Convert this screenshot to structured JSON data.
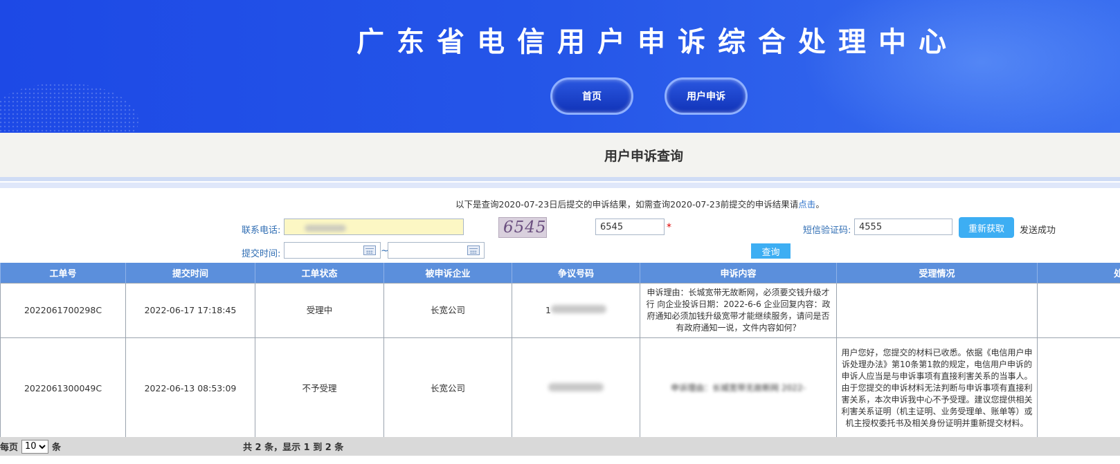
{
  "header": {
    "title": "广东省电信用户申诉综合处理中心",
    "nav": [
      {
        "label": "首页"
      },
      {
        "label": "用户申诉"
      }
    ]
  },
  "section": {
    "title": "用户申诉查询"
  },
  "notice": {
    "text": "以下是查询2020-07-23日后提交的申诉结果，如需查询2020-07-23前提交的申诉结果请",
    "link": "点击",
    "tail": "。"
  },
  "form": {
    "phone_label": "联系电话:",
    "phone_value": "",
    "captcha_image_text": "6545",
    "captcha_value": "6545",
    "required_mark": "*",
    "sms_label": "短信验证码:",
    "sms_value": "4555",
    "resend_label": "重新获取",
    "send_status": "发送成功",
    "time_label": "提交时间:",
    "range_separator": "~",
    "query_label": "查询"
  },
  "table": {
    "headers": [
      "工单号",
      "提交时间",
      "工单状态",
      "被申诉企业",
      "争议号码",
      "申诉内容",
      "受理情况",
      "处"
    ],
    "rows": [
      {
        "order_no": "2022061700298C",
        "submit_time": "2022-06-17 17:18:45",
        "status": "受理中",
        "company": "长宽公司",
        "number": "1",
        "content": "申诉理由：长城宽带无故断网，必须要交钱升级才行 向企业投诉日期：2022-6-6 企业回复内容：政府通知必须加钱升级宽带才能继续服务，请问是否有政府通知一说，文件内容如何？",
        "handling": ""
      },
      {
        "order_no": "2022061300049C",
        "submit_time": "2022-06-13 08:53:09",
        "status": "不予受理",
        "company": "长宽公司",
        "number": "",
        "content": "申诉理由：长城宽带无故断网 2022-",
        "handling": "用户您好，您提交的材料已收悉。依据《电信用户申诉处理办法》第10条第1款的规定，电信用户申诉的申诉人应当是与申诉事项有直接利害关系的当事人。由于您提交的申诉材料无法判断与申诉事项有直接利害关系，本次申诉我中心不予受理。建议您提供相关利害关系证明（机主证明、业务受理单、账单等）或机主授权委托书及相关身份证明并重新提交材料。"
      }
    ]
  },
  "footer": {
    "per_page_label": "每页",
    "per_page_value": "10",
    "per_page_unit": "条",
    "summary": "共 2 条，显示 1 到 2 条"
  }
}
